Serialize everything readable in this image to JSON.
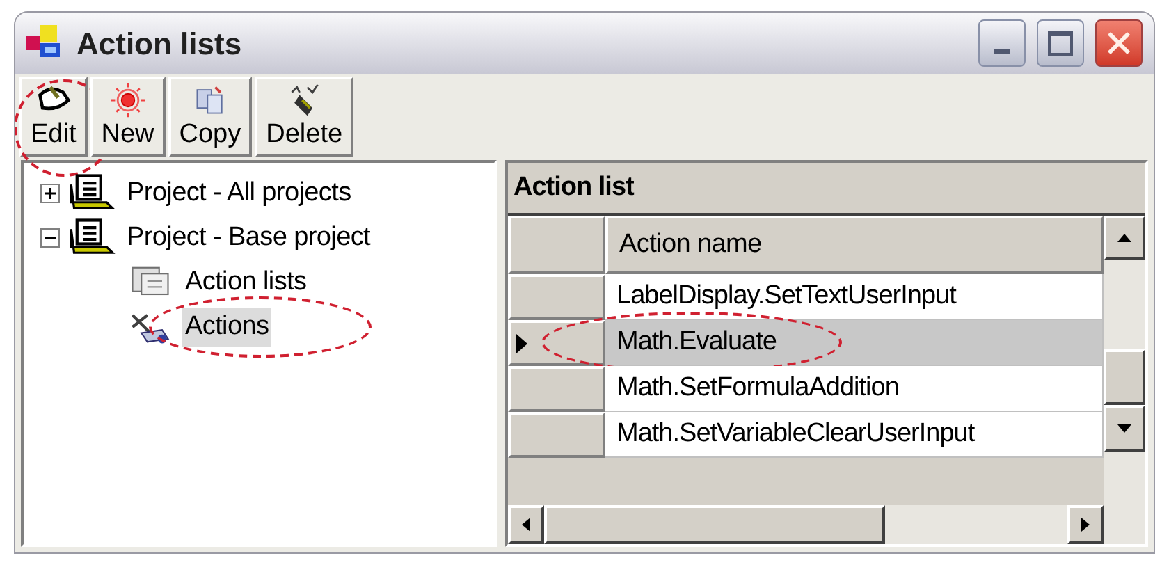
{
  "window": {
    "title": "Action lists"
  },
  "toolbar": {
    "buttons": [
      {
        "label": "Edit",
        "kind": "edit",
        "circled": true
      },
      {
        "label": "New",
        "kind": "new"
      },
      {
        "label": "Copy",
        "kind": "copy"
      },
      {
        "label": "Delete",
        "kind": "delete"
      }
    ]
  },
  "tree": {
    "items": [
      {
        "label": "Project - All projects",
        "kind": "project",
        "expanded": false,
        "selected": false
      },
      {
        "label": "Project - Base project",
        "kind": "project",
        "expanded": true,
        "selected": false,
        "children": [
          {
            "label": "Action lists",
            "kind": "list",
            "selected": false
          },
          {
            "label": "Actions",
            "kind": "actions",
            "selected": true,
            "circled": true
          }
        ]
      }
    ]
  },
  "grid": {
    "caption": "Action list",
    "columns": [
      "Action name"
    ],
    "rows": [
      {
        "cells": [
          "LabelDisplay.SetTextUserInput"
        ],
        "selected": false
      },
      {
        "cells": [
          "Math.Evaluate"
        ],
        "selected": true,
        "circled": true
      },
      {
        "cells": [
          "Math.SetFormulaAddition"
        ],
        "selected": false
      },
      {
        "cells": [
          "Math.SetVariableClearUserInput"
        ],
        "selected": false
      }
    ]
  }
}
